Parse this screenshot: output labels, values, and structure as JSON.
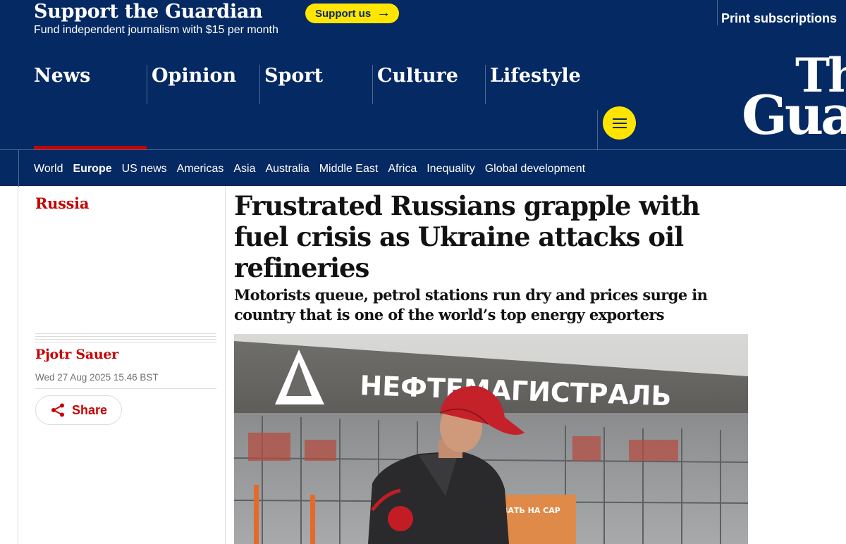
{
  "support": {
    "title": "Support the Guardian",
    "subtitle": "Fund independent journalism with $15 per month",
    "button_label": "Support us",
    "print_label": "Print subscriptions"
  },
  "nav": {
    "pillars": [
      "News",
      "Opinion",
      "Sport",
      "Culture",
      "Lifestyle"
    ],
    "active": "News",
    "logo_line1": "The",
    "logo_line2": "Guardian"
  },
  "subnav": {
    "items": [
      "World",
      "Europe",
      "US news",
      "Americas",
      "Asia",
      "Australia",
      "Middle East",
      "Africa",
      "Inequality",
      "Global development"
    ],
    "active": "Europe"
  },
  "article": {
    "section": "Russia",
    "headline": "Frustrated Russians grapple with fuel crisis as Ukraine attacks oil refineries",
    "standfirst": "Motorists queue, petrol stations run dry and prices surge in country that is one of the world’s top energy exporters",
    "author": "Pjotr Sauer",
    "date": "Wed 27 Aug 2025 15.46 BST",
    "share_label": "Share"
  },
  "photo": {
    "sign_text": "НЕФТЕМАГИСТРАЛЬ",
    "kiosk_text": "ВАТЬ НА САР"
  },
  "colors": {
    "brand_navy": "#052962",
    "support_yellow": "#ffe500",
    "news_red": "#c70000"
  }
}
